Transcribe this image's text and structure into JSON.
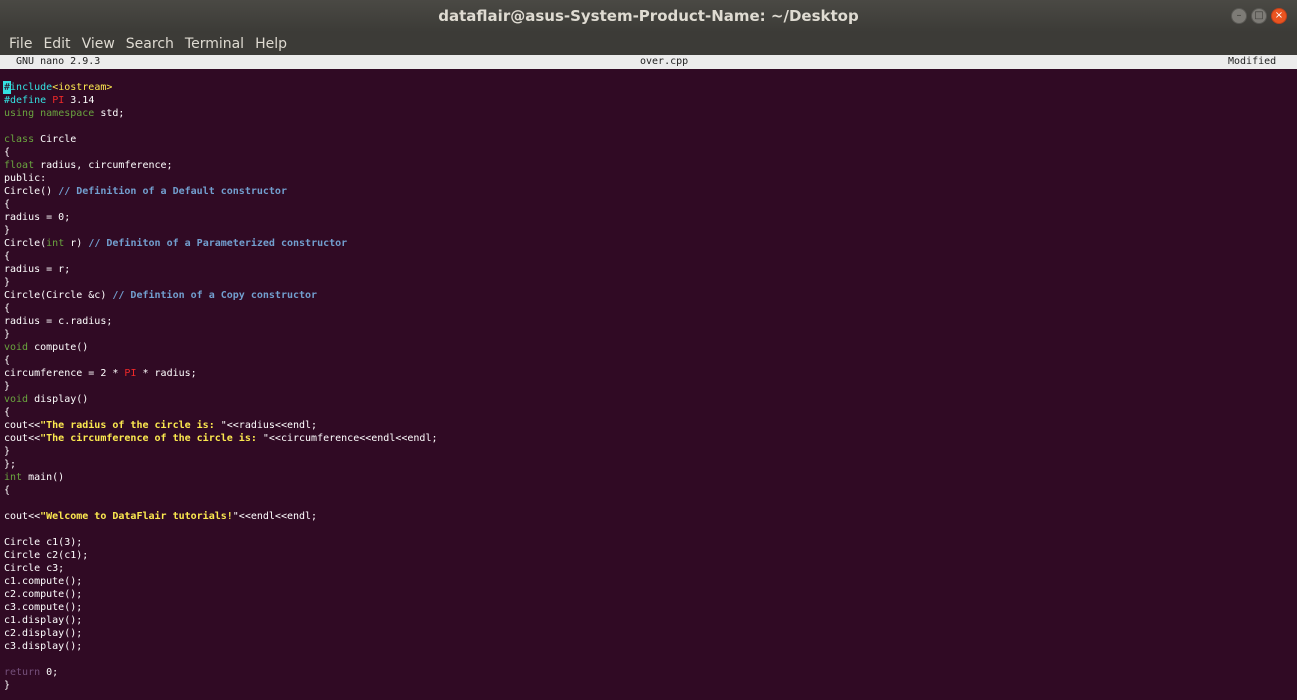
{
  "window": {
    "title": "dataflair@asus-System-Product-Name: ~/Desktop",
    "buttons": {
      "minimize": "–",
      "maximize": "□",
      "close": "×"
    }
  },
  "menu": [
    "File",
    "Edit",
    "View",
    "Search",
    "Terminal",
    "Help"
  ],
  "nano": {
    "version": "GNU nano 2.9.3",
    "filename": "over.cpp",
    "status": "Modified"
  },
  "colors": {
    "background": "#300a24",
    "keyword": "#6aa53f",
    "preprocessor": "#34e2e2",
    "include_header": "#fce94f",
    "macro": "#ef2929",
    "comment": "#729fcf",
    "string": "#fce94f",
    "return_keyword": "#75507b"
  },
  "code": [
    "#include<iostream>",
    "#define PI 3.14",
    "using namespace std;",
    "",
    "class Circle",
    "{",
    "float radius, circumference;",
    "public:",
    "Circle() // Definition of a Default constructor",
    "{",
    "radius = 0;",
    "}",
    "Circle(int r) // Definiton of a Parameterized constructor",
    "{",
    "radius = r;",
    "}",
    "Circle(Circle &c) // Defintion of a Copy constructor",
    "{",
    "radius = c.radius;",
    "}",
    "void compute()",
    "{",
    "circumference = 2 * PI * radius;",
    "}",
    "void display()",
    "{",
    "cout<<\"The radius of the circle is: \"<<radius<<endl;",
    "cout<<\"The circumference of the circle is: \"<<circumference<<endl<<endl;",
    "}",
    "};",
    "int main()",
    "{",
    "",
    "cout<<\"Welcome to DataFlair tutorials!\"<<endl<<endl;",
    "",
    "Circle c1(3);",
    "Circle c2(c1);",
    "Circle c3;",
    "c1.compute();",
    "c2.compute();",
    "c3.compute();",
    "c1.display();",
    "c2.display();",
    "c3.display();",
    "",
    "return 0;",
    "}"
  ]
}
